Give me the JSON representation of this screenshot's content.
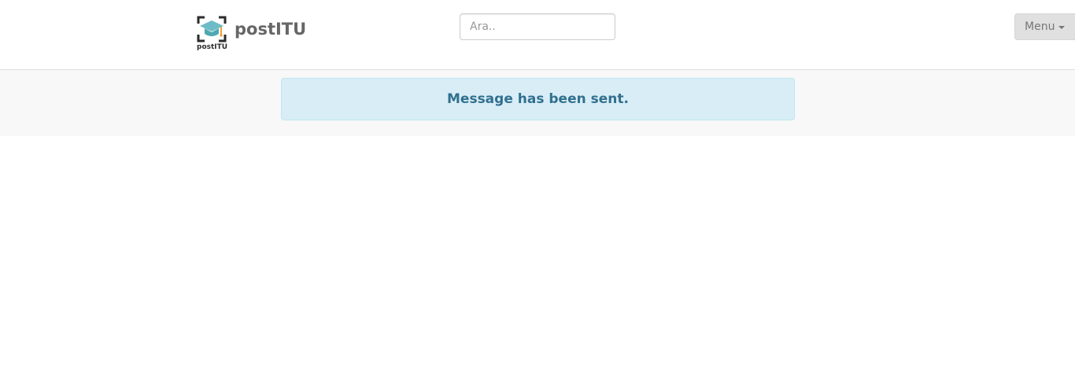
{
  "header": {
    "logo_caption": "postITU",
    "brand_name": "postITU",
    "search": {
      "placeholder": "Ara.."
    },
    "menu": {
      "label": "Menu"
    }
  },
  "alert": {
    "message": "Message has been sent."
  },
  "colors": {
    "logo_cap": "#6bbcc6",
    "logo_bracket": "#2b2b2b",
    "logo_tassel": "#f0a030",
    "alert_bg": "#d9edf7",
    "alert_text": "#31708f",
    "menu_bg": "#e0e0e0"
  },
  "icons": {
    "logo": "graduation-cap-icon",
    "menu_caret": "caret-down-icon"
  }
}
